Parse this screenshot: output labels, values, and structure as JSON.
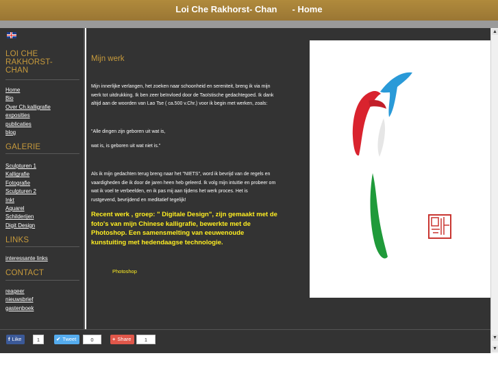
{
  "header": {
    "name": "Loi Che Rakhorst- Chan",
    "page": "- Home"
  },
  "sidebar": {
    "language_icon": "uk-flag-icon",
    "title": "LOI CHE RAKHORST-CHAN",
    "title_lines": [
      "LOI CHE",
      "RAKHORST-",
      "CHAN"
    ],
    "main_menu": [
      "Home",
      "Bio",
      "Over Ch.kalligrafie",
      "exposities",
      "publicaties",
      "blog"
    ],
    "galerie_heading": "GALERIE",
    "galerie_menu": [
      "Sculpturen 1",
      "Kalligrafie",
      "Fotografie",
      "Sculpturen 2",
      "Inkt",
      "Aquarel",
      "Schilderijen",
      "Digit Design"
    ],
    "links_heading": "LINKS",
    "links_menu": [
      "interessante links"
    ],
    "contact_heading": "CONTACT",
    "contact_menu": [
      "reageer",
      "nieuwsbrief",
      "gastenboek"
    ]
  },
  "content": {
    "heading": "Mijn werk",
    "intro_lines": [
      "Mijn innerlijke verlangen, het zoeken naar schoonheid en sereniteit, breng ik  via mijn",
      "werk tot uitdrukking. Ik ben zeer beïnvloed door de Taoïstische gedachtegoed. Ik dank",
      "altijd aan de woorden van Lao Tse ( ca.500 v.Chr.) voor ik begin met werken, zoals:"
    ],
    "quote_line1": "\"Alle dingen zijn geboren uit wat is,",
    "quote_line2": " wat is, is geboren uit wat niet is.\"",
    "body_lines": [
      "Als ik mijn gedachten terug breng naar het  \"NIETS\", word ik bevrijd van de regels en",
      "vaardigheden die ik door de jaren heen heb geleerd. Ik volg mijn intuïtie en probeer om",
      "wat ik voel te verbeelden, en ik pas mij aan tijdens het werk proces. Het is",
      "rustgevend, bevrijdend en meditatief tegelijk!"
    ],
    "highlight_lines": [
      "Recent werk , groep: \" Digitale Design\",  zijn gemaakt met de",
      "foto's van mijn Chinese kalligrafie, bewerkte met de",
      "Photoshop. Een samensmelting van eeuwenoude",
      "kunstuiting met  hedendaagse technologie."
    ],
    "link_label": "Photoshop"
  },
  "social": {
    "like_label": "Like",
    "like_count": "1",
    "tweet_label": "Tweet",
    "tweet_count": "0",
    "share_label": "Share",
    "share_count": "1"
  },
  "colors": {
    "header_gold": "#b08a3c",
    "panel_dark": "#333333",
    "accent_gold": "#c89b3c",
    "highlight_yellow": "#ffee22",
    "art_red": "#d9232e",
    "art_blue": "#2a9ad8",
    "art_green": "#1f9a3a"
  }
}
